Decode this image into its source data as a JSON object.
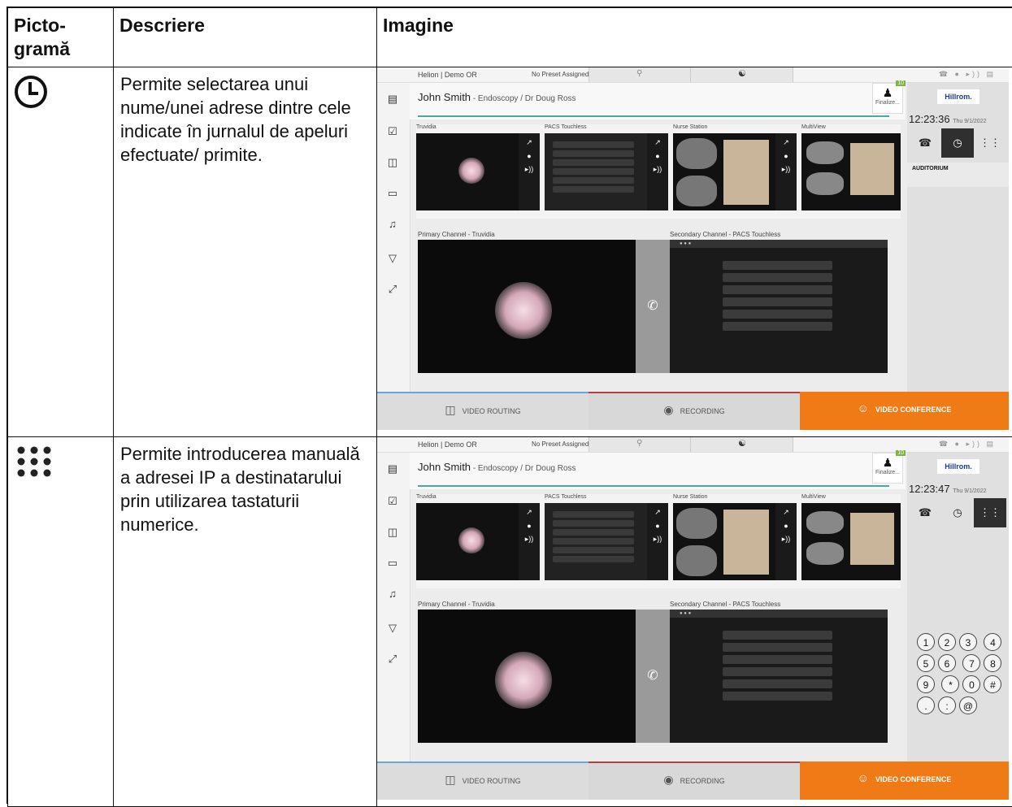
{
  "headers": {
    "pictogram": "Picto-\ngramă",
    "description": "Descriere",
    "image": "Imagine"
  },
  "rows": [
    {
      "icon_name": "clock-icon",
      "description": "Permite selectarea unui nume/unei adrese dintre cele indicate în jurnalul de apeluri efectuate/ primite."
    },
    {
      "icon_name": "keypad-icon",
      "description": "Permite introducerea manuală a adresei IP a destinatarului prin utilizarea tastaturii numerice."
    }
  ],
  "screenshot": {
    "room": "Helion | Demo OR",
    "preset": "No Preset Assigned",
    "patient_name": "John Smith",
    "patient_detail": " - Endoscopy / Dr Doug Ross",
    "finalize_label": "Finalize...",
    "finalize_badge": "10",
    "brand": "Hillrom.",
    "date": "Thu 9/1/2022",
    "sources": [
      "Truvidia",
      "PACS Touchless",
      "Nurse Station",
      "MultiView"
    ],
    "primary_channel": "Primary Channel - Truvidia",
    "secondary_channel": "Secondary Channel - PACS Touchless",
    "auditorium": "AUDITORIUM",
    "tabs": {
      "routing": "VIDEO ROUTING",
      "recording": "RECORDING",
      "conference": "VIDEO CONFERENCE"
    }
  },
  "shots": [
    {
      "time": "12:23:36",
      "active_button": "clock"
    },
    {
      "time": "12:23:47",
      "active_button": "keypad"
    }
  ],
  "keypad_keys": [
    "1",
    "2",
    "3",
    "4",
    "5",
    "6",
    "7",
    "8",
    "9",
    "*",
    "0",
    "#",
    ".",
    ":",
    "@"
  ],
  "colors": {
    "accent_orange": "#f07a16",
    "teal_line": "#4aa99a",
    "brand_blue": "#1a3a8a"
  }
}
